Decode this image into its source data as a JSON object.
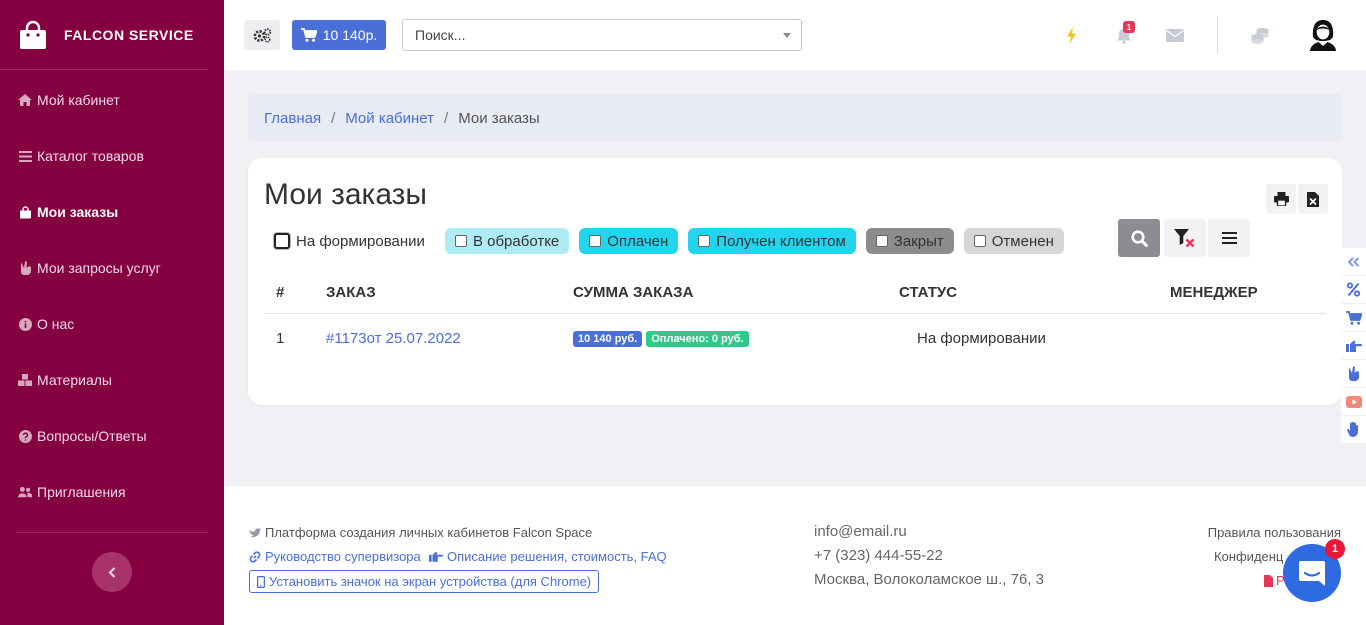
{
  "brand": {
    "name": "FALCON SERVICE",
    "icon": "shopping-bag-icon"
  },
  "sidebar": {
    "items": [
      {
        "label": "Мой кабинет",
        "icon": "home-icon",
        "active": false
      },
      {
        "label": "Каталог товаров",
        "icon": "list-icon",
        "active": false
      },
      {
        "label": "Мои заказы",
        "icon": "shopping-bag-icon",
        "active": true
      },
      {
        "label": "Мои запросы услуг",
        "icon": "hand-peace-icon",
        "active": false
      },
      {
        "label": "О нас",
        "icon": "info-icon",
        "active": false
      },
      {
        "label": "Материалы",
        "icon": "boxes-icon",
        "active": false
      },
      {
        "label": "Вопросы/Ответы",
        "icon": "question-icon",
        "active": false
      },
      {
        "label": "Приглашения",
        "icon": "users-icon",
        "active": false
      }
    ],
    "collapse_icon": "chevron-left-icon"
  },
  "topbar": {
    "cart_label": "10 140р.",
    "search_placeholder": "Поиск...",
    "notifications_count": "1"
  },
  "breadcrumb": {
    "home": "Главная",
    "cabinet": "Мой кабинет",
    "current": "Мои заказы",
    "separator": "/"
  },
  "main": {
    "title": "Мои заказы",
    "filters": [
      {
        "label": "На формировании",
        "style": "plain"
      },
      {
        "label": "В обработке",
        "style": "proc"
      },
      {
        "label": "Оплачен",
        "style": "paid"
      },
      {
        "label": "Получен клиентом",
        "style": "recv"
      },
      {
        "label": "Закрыт",
        "style": "closed"
      },
      {
        "label": "Отменен",
        "style": "cancel"
      }
    ],
    "table": {
      "columns": [
        "#",
        "ЗАКАЗ",
        "СУММА ЗАКАЗА",
        "СТАТУС",
        "МЕНЕДЖЕР"
      ],
      "rows": [
        {
          "num": "1",
          "order": "#1173от 25.07.2022",
          "sum": "10 140 руб.",
          "paid": "Оплачено: 0 руб.",
          "status": "На формировании",
          "manager": ""
        }
      ]
    }
  },
  "footer": {
    "platform": "Платформа создания личных кабинетов Falcon Space",
    "guide": "Руководство супервизора",
    "description": "Описание решения, стоимость, FAQ",
    "install": "Установить значок на экран устройства (для Chrome)",
    "email": "info@email.ru",
    "phone": "+7 (323) 444-55-22",
    "address": "Москва, Волоколамское ш., 76, 3",
    "rules": "Правила пользования",
    "privacy": "Конфиденц",
    "pdf": "Р"
  },
  "chat": {
    "badge": "1"
  },
  "colors": {
    "sidebar": "#850040",
    "accent": "#4a6fd8",
    "cyan": "#22d5ee",
    "success": "#2ccb8a"
  }
}
